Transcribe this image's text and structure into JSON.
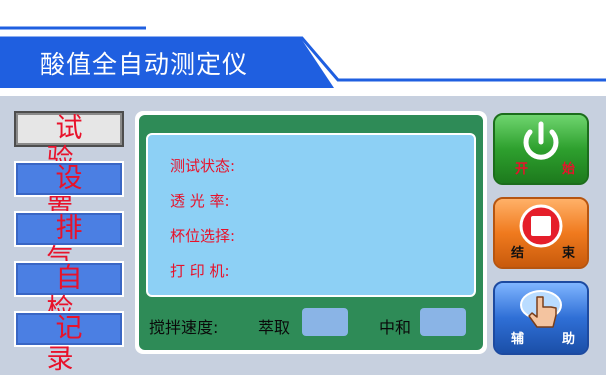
{
  "window": {
    "title": "酸值全自动测定仪"
  },
  "nav": {
    "items": [
      {
        "label": "试验",
        "active": true
      },
      {
        "label": "设置",
        "active": false
      },
      {
        "label": "排气",
        "active": false
      },
      {
        "label": "自检",
        "active": false
      },
      {
        "label": "记录",
        "active": false
      }
    ]
  },
  "status": {
    "test_state_label": "测试状态:",
    "transmittance_label": "透 光 率:",
    "cup_select_label": "杯位选择:",
    "printer_label": "打 印 机:"
  },
  "stir": {
    "label": "搅拌速度:",
    "extract_label": "萃取",
    "neutralize_label": "中和"
  },
  "actions": {
    "start": {
      "label_left": "开",
      "label_right": "始",
      "icon": "power-icon",
      "color": "#2ea02e"
    },
    "end": {
      "label_left": "结",
      "label_right": "束",
      "icon": "stop-icon",
      "color": "#f07a1e"
    },
    "assist": {
      "label_left": "辅",
      "label_right": "助",
      "icon": "hand-pointer-icon",
      "color": "#2f6fd6"
    }
  },
  "colors": {
    "accent_blue": "#1f5fe0",
    "nav_text": "#e8122b",
    "panel_green": "#2e8b57",
    "screen_blue": "#8dd0f5",
    "background": "#c7d0df"
  }
}
